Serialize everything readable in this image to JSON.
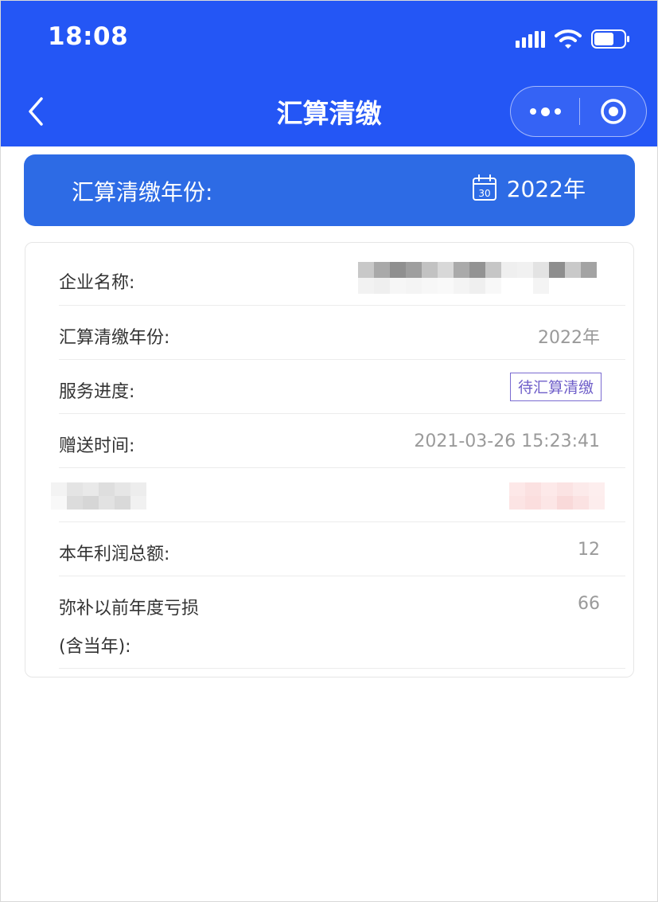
{
  "status_bar": {
    "time": "18:08"
  },
  "nav": {
    "title": "汇算清缴"
  },
  "year_banner": {
    "label": "汇算清缴年份:",
    "calendar_day": "30",
    "year": "2022年"
  },
  "details": {
    "company_label": "企业名称:",
    "year_label": "汇算清缴年份:",
    "year_value": "2022年",
    "progress_label": "服务进度:",
    "progress_badge": "待汇算清缴",
    "gift_time_label": "赠送时间:",
    "gift_time_value": "2021-03-26 15:23:41",
    "profit_label": "本年利润总额:",
    "profit_value": "12",
    "loss_label_line1": "弥补以前年度亏损",
    "loss_label_line2": "(含当年):",
    "loss_value": "66"
  },
  "colors": {
    "header_blue": "#2456f5",
    "banner_blue": "#2d6be5",
    "badge_purple": "#6f5fc9"
  }
}
